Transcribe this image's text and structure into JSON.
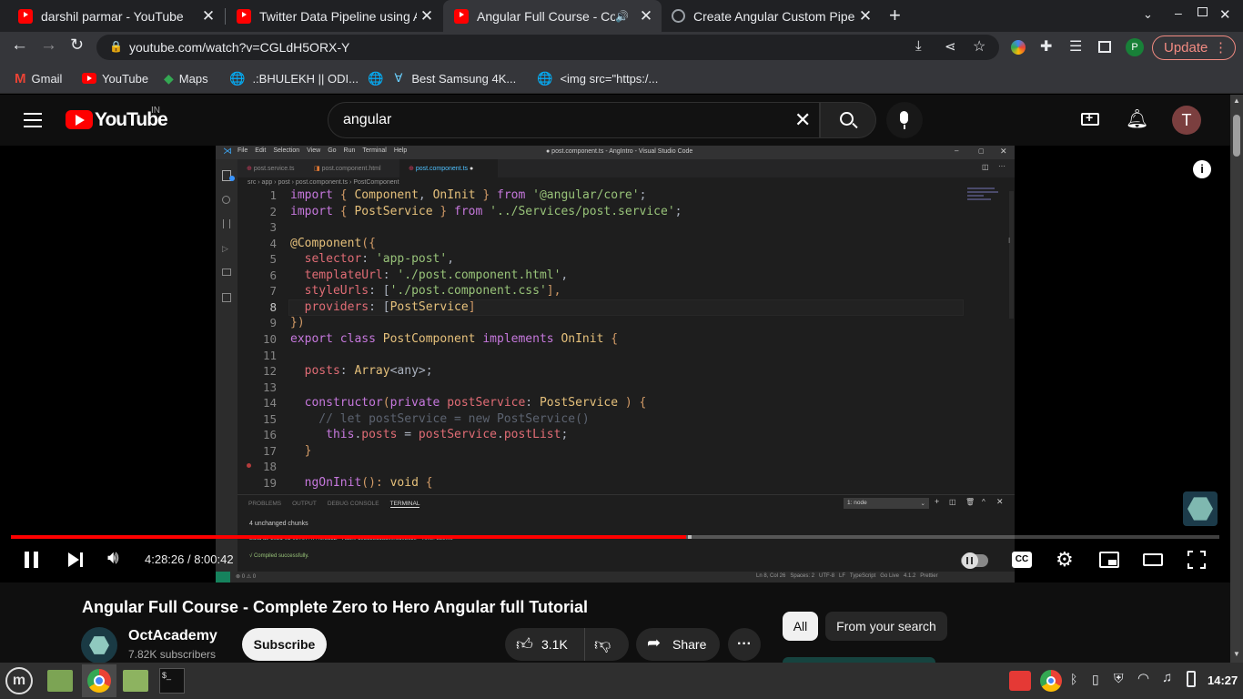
{
  "browser": {
    "tabs": [
      {
        "title": "darshil parmar - YouTube",
        "icon": "youtube-icon"
      },
      {
        "title": "Twitter Data Pipeline using Ai",
        "icon": "youtube-icon"
      },
      {
        "title": "Angular Full Course - Com",
        "icon": "youtube-icon",
        "active": true
      },
      {
        "title": "Create Angular Custom Pipes",
        "icon": "chatgpt-icon"
      }
    ],
    "new_tab_icon": "plus-icon",
    "address": "youtube.com/watch?v=CGLdH5ORX-Y",
    "profile_letter": "P",
    "update_label": "Update",
    "bookmarks": [
      "Gmail",
      "YouTube",
      "Maps",
      ".:BHULEKH || ODI...",
      "Best Samsung 4K...",
      "<img src=\"https:/..."
    ]
  },
  "youtube": {
    "logo_text": "YouTube",
    "logo_region": "IN",
    "search_value": "angular",
    "avatar_letter": "T",
    "video": {
      "current_time": "4:28:26",
      "duration": "8:00:42",
      "time_sep": " / ",
      "progress": 0.559,
      "title": "Angular Full Course - Complete Zero to Hero Angular full Tutorial",
      "channel": "OctAcademy",
      "subscribers": "7.82K subscribers",
      "subscribe_label": "Subscribe",
      "likes": "3.1K",
      "share_label": "Share",
      "chips": [
        "All",
        "From your search"
      ]
    }
  },
  "vscode": {
    "menu": [
      "File",
      "Edit",
      "Selection",
      "View",
      "Go",
      "Run",
      "Terminal",
      "Help"
    ],
    "window_title": "● post.component.ts - AngIntro - Visual Studio Code",
    "tabs": [
      "post.service.ts",
      "post.component.html",
      "post.component.ts"
    ],
    "breadcrumb": "src › app › post › post.component.ts › PostComponent",
    "lines": [
      {
        "n": "1",
        "text": "import { Component, OnInit } from '@angular/core';"
      },
      {
        "n": "2",
        "text": "import { PostService } from '../Services/post.service';"
      },
      {
        "n": "3",
        "text": ""
      },
      {
        "n": "4",
        "text": "@Component({"
      },
      {
        "n": "5",
        "text": "  selector: 'app-post',"
      },
      {
        "n": "6",
        "text": "  templateUrl: './post.component.html',"
      },
      {
        "n": "7",
        "text": "  styleUrls: ['./post.component.css'],"
      },
      {
        "n": "8",
        "text": "  providers: [PostService]"
      },
      {
        "n": "9",
        "text": "})"
      },
      {
        "n": "10",
        "text": "export class PostComponent implements OnInit {"
      },
      {
        "n": "11",
        "text": ""
      },
      {
        "n": "12",
        "text": "  posts: Array<any>;"
      },
      {
        "n": "13",
        "text": ""
      },
      {
        "n": "14",
        "text": "  constructor(private postService: PostService ) {"
      },
      {
        "n": "15",
        "text": "    // let postService = new PostService()"
      },
      {
        "n": "16",
        "text": "     this.posts = postService.postList;"
      },
      {
        "n": "17",
        "text": "  }"
      },
      {
        "n": "18",
        "text": ""
      },
      {
        "n": "19",
        "text": "  ngOnInit(): void {"
      }
    ],
    "panel_tabs": [
      "PROBLEMS",
      "OUTPUT",
      "DEBUG CONSOLE",
      "TERMINAL"
    ],
    "terminal_select": "1: node",
    "terminal_lines": [
      "4 unchanged chunks",
      "Build at: 2021-01-09T07:47:49.855Z - Hash: 1e3538d1dde0f6d0bc1e - Time: 389ms",
      "√ Compiled successfully."
    ],
    "status": "Ln 8, Col 26   Spaces: 2   UTF-8   LF   TypeScript   Go Live   4.1.2   Prettier"
  },
  "taskbar": {
    "clock": "14:27"
  },
  "colors": {
    "yt_red": "#ff0000",
    "accent": "#3ea6ff"
  }
}
